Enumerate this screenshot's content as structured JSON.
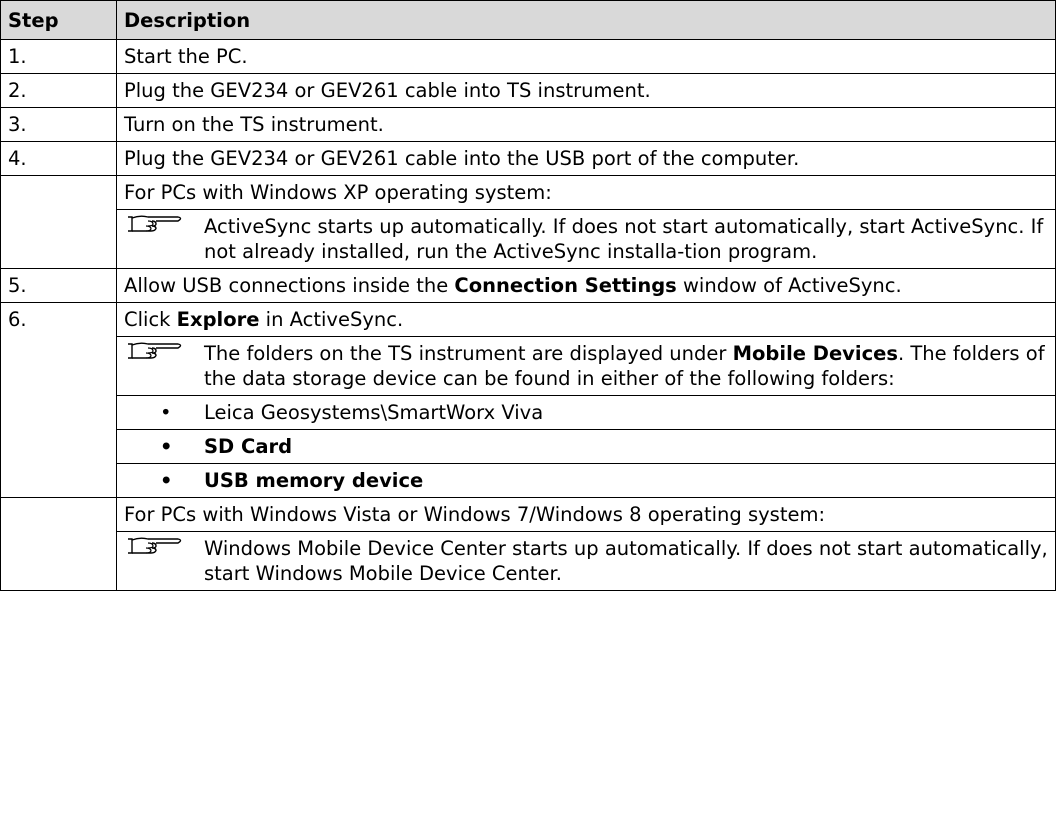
{
  "table": {
    "header_step": "Step",
    "header_description": "Description",
    "rows": [
      {
        "step": "1.",
        "text": "Start the PC."
      },
      {
        "step": "2.",
        "text": "Plug the GEV234 or GEV261 cable into TS instrument."
      },
      {
        "step": "3.",
        "text": "Turn on the TS instrument."
      },
      {
        "step": "4.",
        "text": "Plug the GEV234 or GEV261 cable into the USB port of the computer."
      }
    ],
    "xp_block": {
      "heading": "For PCs with Windows XP operating system:",
      "note": "ActiveSync starts up automatically. If does not start automatically, start ActiveSync. If not already installed, run the ActiveSync installa-tion program."
    },
    "row5": {
      "step": "5.",
      "pre": "Allow USB connections inside the ",
      "bold": "Connection Settings",
      "post": " window of ActiveSync."
    },
    "row6": {
      "step": "6.",
      "pre": "Click ",
      "bold": "Explore",
      "post": " in ActiveSync.",
      "note_pre": "The folders on the TS instrument are displayed under ",
      "note_bold": "Mobile Devices",
      "note_post": ". The folders of the data storage device can be found in either of the following folders:",
      "bullets": [
        {
          "text": "Leica Geosystems\\SmartWorx Viva",
          "bold": false
        },
        {
          "text": "SD Card",
          "bold": true
        },
        {
          "text": "USB memory device",
          "bold": true
        }
      ]
    },
    "vista_block": {
      "heading": "For PCs with Windows Vista or Windows 7/Windows 8 operating system:",
      "note": "Windows Mobile Device Center starts up automatically. If does not start automatically, start Windows Mobile Device Center."
    },
    "note_icon": "pointing-hand-icon",
    "bullet_symbol": "•"
  }
}
